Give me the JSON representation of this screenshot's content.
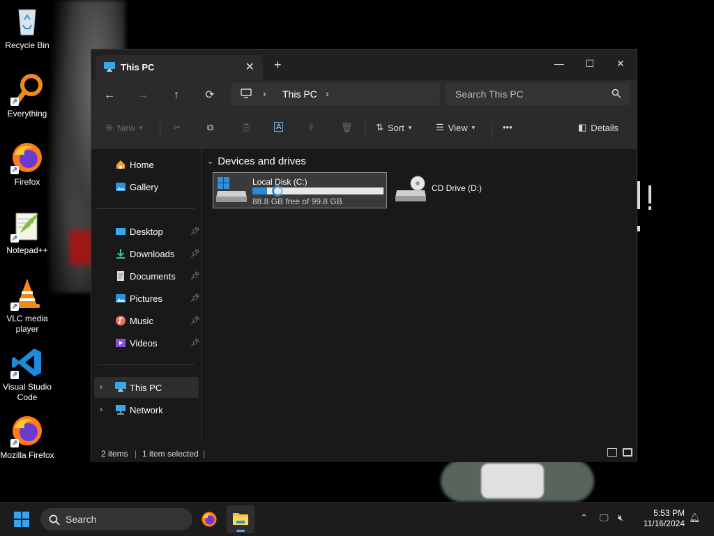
{
  "desktop": {
    "icons": [
      {
        "label": "Recycle Bin"
      },
      {
        "label": "Everything"
      },
      {
        "label": "Firefox"
      },
      {
        "label": "Notepad++"
      },
      {
        "label": "VLC media player"
      },
      {
        "label": "Visual Studio Code"
      },
      {
        "label": "Mozilla Firefox"
      }
    ]
  },
  "window": {
    "tab_title": "This PC",
    "address": {
      "crumb": "This PC"
    },
    "search_placeholder": "Search This PC",
    "toolbar": {
      "new_label": "New",
      "sort_label": "Sort",
      "view_label": "View",
      "more_label": "•••",
      "details_label": "Details"
    },
    "sidebar": {
      "home": "Home",
      "gallery": "Gallery",
      "desktop": "Desktop",
      "downloads": "Downloads",
      "documents": "Documents",
      "pictures": "Pictures",
      "music": "Music",
      "videos": "Videos",
      "this_pc": "This PC",
      "network": "Network"
    },
    "content": {
      "group_title": "Devices and drives",
      "drives": [
        {
          "name": "Local Disk (C:)",
          "free_text": "88.8 GB free of 99.8 GB",
          "used_fraction": 0.11
        },
        {
          "name": "CD Drive (D:)"
        }
      ]
    },
    "status": {
      "items": "2 items",
      "selected": "1 item selected"
    }
  },
  "taskbar": {
    "search_placeholder": "Search",
    "time": "5:53 PM",
    "date": "11/16/2024"
  },
  "colors": {
    "accent": "#2b8ad8",
    "window_bg": "#191919",
    "toolbar_bg": "#2b2b2b"
  }
}
